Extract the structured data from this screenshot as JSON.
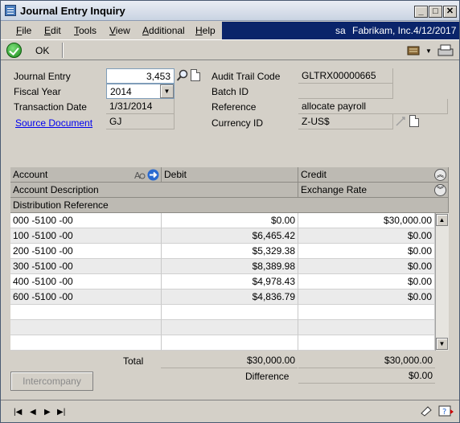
{
  "window": {
    "title": "Journal Entry Inquiry"
  },
  "menu": {
    "items": [
      {
        "key": "F",
        "rest": "ile"
      },
      {
        "key": "E",
        "rest": "dit"
      },
      {
        "key": "T",
        "rest": "ools"
      },
      {
        "key": "V",
        "rest": "iew"
      },
      {
        "key": "A",
        "rest": "dditional"
      },
      {
        "key": "H",
        "rest": "elp"
      }
    ],
    "user": "sa",
    "company": "Fabrikam, Inc.",
    "date": "4/12/2017"
  },
  "toolbar": {
    "ok_label": "OK"
  },
  "form": {
    "journal_entry_label": "Journal Entry",
    "journal_entry_value": "3,453",
    "fiscal_year_label": "Fiscal Year",
    "fiscal_year_value": "2014",
    "transaction_date_label": "Transaction Date",
    "transaction_date_value": "1/31/2014",
    "source_document_label": "Source Document",
    "source_document_value": "GJ",
    "audit_trail_label": "Audit Trail Code",
    "audit_trail_value": "GLTRX00000665",
    "batch_id_label": "Batch ID",
    "batch_id_value": "",
    "reference_label": "Reference",
    "reference_value": "allocate payroll",
    "currency_id_label": "Currency ID",
    "currency_id_value": "Z-US$"
  },
  "grid": {
    "headers": {
      "account": "Account",
      "debit": "Debit",
      "credit": "Credit",
      "account_description": "Account Description",
      "exchange_rate": "Exchange Rate",
      "distribution_reference": "Distribution Reference"
    },
    "rows": [
      {
        "account": "000 -5100 -00",
        "debit": "$0.00",
        "credit": "$30,000.00"
      },
      {
        "account": "100 -5100 -00",
        "debit": "$6,465.42",
        "credit": "$0.00"
      },
      {
        "account": "200 -5100 -00",
        "debit": "$5,329.38",
        "credit": "$0.00"
      },
      {
        "account": "300 -5100 -00",
        "debit": "$8,389.98",
        "credit": "$0.00"
      },
      {
        "account": "400 -5100 -00",
        "debit": "$4,978.43",
        "credit": "$0.00"
      },
      {
        "account": "600 -5100 -00",
        "debit": "$4,836.79",
        "credit": "$0.00"
      }
    ]
  },
  "totals": {
    "total_label": "Total",
    "total_debit": "$30,000.00",
    "total_credit": "$30,000.00",
    "difference_label": "Difference",
    "difference_value": "$0.00"
  },
  "buttons": {
    "intercompany": "Intercompany"
  }
}
